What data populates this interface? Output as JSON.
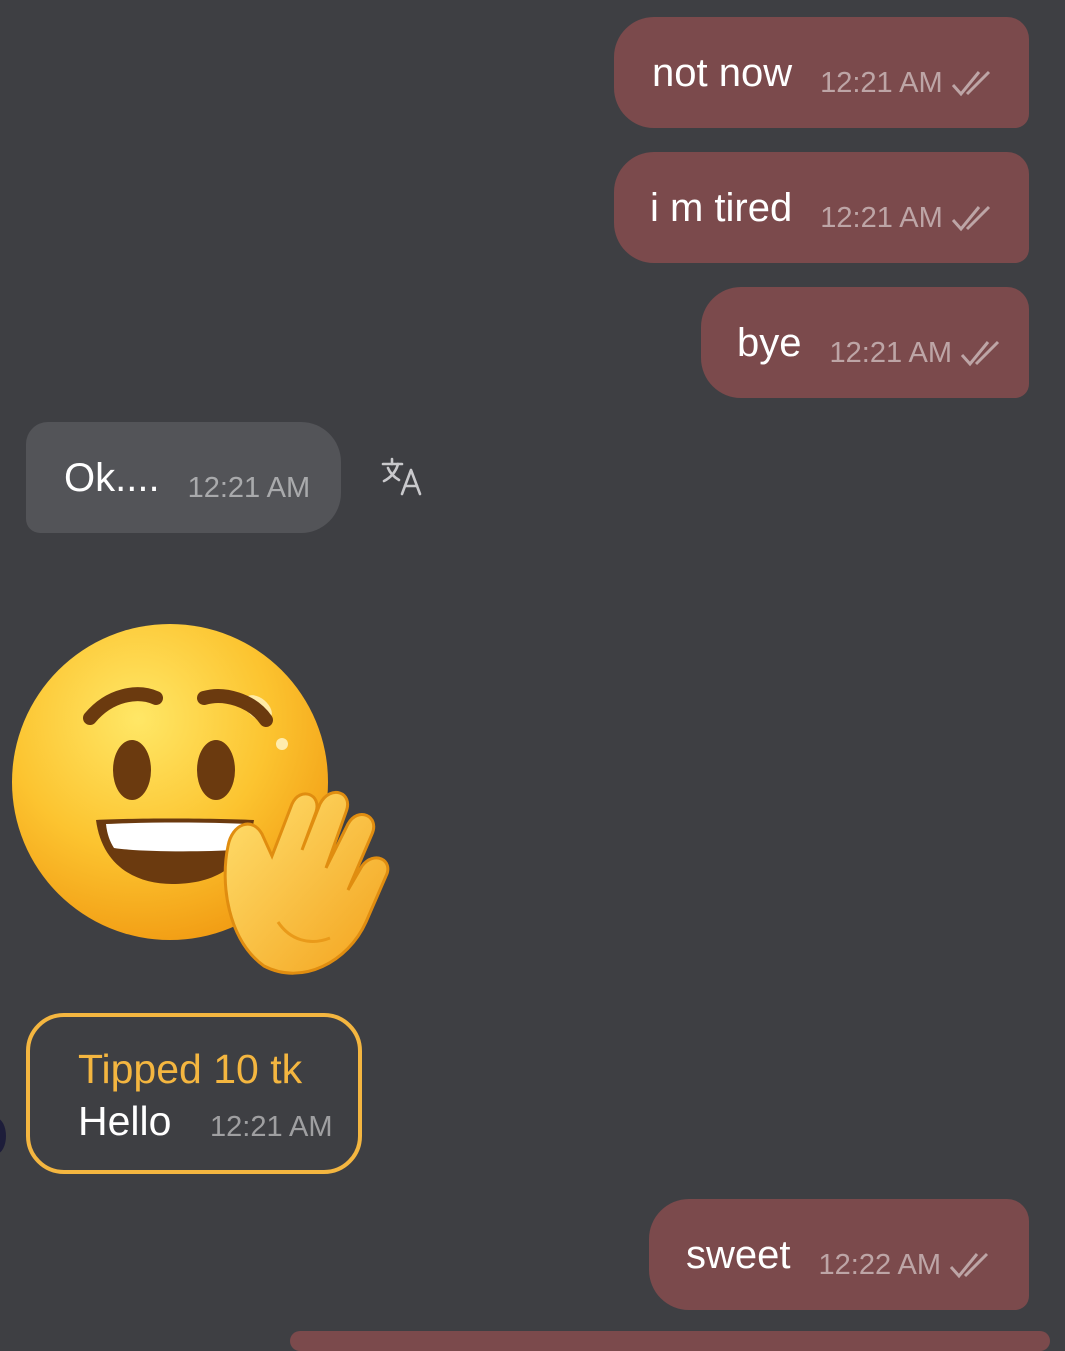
{
  "messages": [
    {
      "text": "not now",
      "time": "12:21 AM",
      "status_icon": "double-check-icon"
    },
    {
      "text": "i m tired",
      "time": "12:21 AM",
      "status_icon": "double-check-icon"
    },
    {
      "text": "bye",
      "time": "12:21 AM",
      "status_icon": "double-check-icon"
    },
    {
      "text": "Ok....",
      "time": "12:21 AM"
    },
    {
      "sticker": "smiling-face-waving-hand-sticker"
    },
    {
      "tip_label": "Tipped 10 tk",
      "text": "Hello",
      "time": "12:21 AM"
    },
    {
      "text": "sweet",
      "time": "12:22 AM",
      "status_icon": "double-check-icon"
    }
  ],
  "icons": {
    "translate": "translate-icon",
    "read_receipt": "double-check-icon"
  },
  "colors": {
    "background": "#3e3f43",
    "outgoing_bubble": "#7b4a4c",
    "incoming_bubble": "#535458",
    "tip_accent": "#f4b640"
  }
}
